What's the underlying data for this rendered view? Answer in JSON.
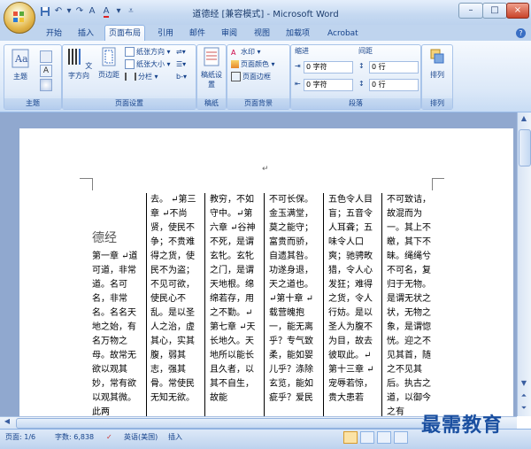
{
  "window": {
    "title": "道德经 [兼容模式] - Microsoft Word",
    "controls": [
      "–",
      "□",
      "×"
    ]
  },
  "tabs": [
    {
      "label": "开始"
    },
    {
      "label": "插入"
    },
    {
      "label": "页面布局",
      "active": true
    },
    {
      "label": "引用"
    },
    {
      "label": "邮件"
    },
    {
      "label": "审阅"
    },
    {
      "label": "视图"
    },
    {
      "label": "加载项"
    },
    {
      "label": "Acrobat"
    }
  ],
  "ribbon": {
    "theme_group": {
      "label": "主题",
      "theme_btn": "主题"
    },
    "page_setup": {
      "label": "页面设置",
      "text_direction": "文字方向",
      "margins": "页边距",
      "orientation": "纸张方向",
      "size": "纸张大小",
      "columns": "分栏"
    },
    "manuscript": {
      "label": "稿纸",
      "btn": "稿纸设置"
    },
    "page_background": {
      "label": "页面背景",
      "watermark": "水印",
      "page_color": "页面颜色",
      "page_borders": "页面边框"
    },
    "paragraph": {
      "label": "段落",
      "indent_header": "缩进",
      "spacing_header": "间距",
      "indent_left": "0 字符",
      "indent_right": "0 字符",
      "spacing_before": "0 行",
      "spacing_after": "0 行"
    },
    "arrange": {
      "label": "排列",
      "btn": "排列"
    }
  },
  "document": {
    "heading": "德经",
    "columns": [
      "第一章 ↵道可道，非常道。名可名，非常名。名名天地之始，有名万物之母。故常无欲以观其妙，常有欲以观其微。此两",
      "去。 ↵第三章 ↵不尚贤，使民不争；不贵难得之货，使民不为盗；不见可欲，使民心不乱。是以圣人之治，虚其心，实其腹，弱其志，强其骨。常使民无知无欲。",
      "教穷，不如守中。↵第六章 ↵谷神不死，是谓玄牝。玄牝之门，是谓天地根。绵绵若存，用之不勤。↵第七章 ↵天长地久。天地所以能长且久者，以其不自生，故能",
      "不可长保。金玉满堂，莫之能守；富贵而骄，自遗其咎。功遂身退，天之道也。↵第十章 ↵载营魄抱一，能无离乎？专气致柔，能如婴儿乎？涤除玄览，能如疵乎？爱民",
      "五色令人目盲；五音令人耳聋；五味令人口爽；驰骋畋猎，令人心发狂；难得之货，令人行妨。是以圣人为腹不为目，故去彼取此。↵第十三章 ↵宠辱若惊，贵大患若",
      "不可致诘，故混而为一。其上不皦，其下不昧。绳绳兮不可名，复归于无物。是谓无状之状，无物之象，是谓惚恍。迎之不见其首，随之不见其后。执古之道，以御今之有"
    ]
  },
  "status": {
    "page": "页面: 1/6",
    "words": "字数: 6,838",
    "language": "英语(美国)",
    "mode": "插入"
  },
  "watermark_text": "最需教育"
}
